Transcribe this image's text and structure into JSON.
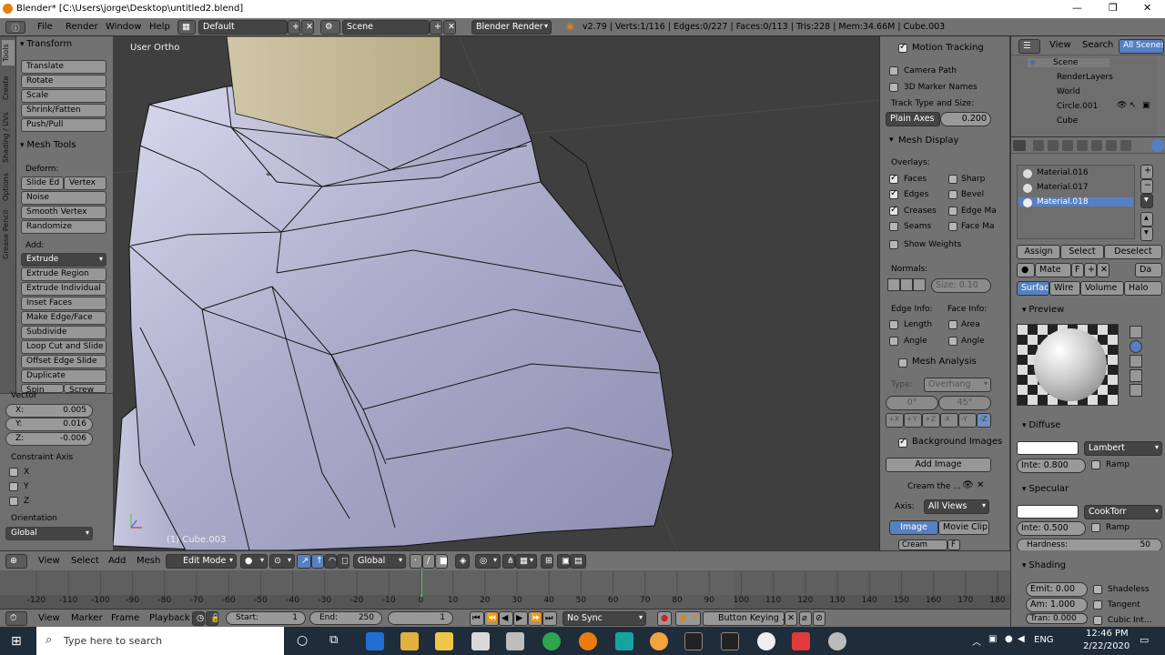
{
  "window": {
    "title": "Blender* [C:\\Users\\jorge\\Desktop\\untitled2.blend]"
  },
  "menus": [
    "File",
    "Render",
    "Window",
    "Help"
  ],
  "layout": "Default",
  "scene": "Scene",
  "engine": "Blender Render",
  "stats": "v2.79 | Verts:1/116 | Edges:0/227 | Faces:0/113 | Tris:228 | Mem:34.66M | Cube.003",
  "tabs": [
    "Tools",
    "Create",
    "Shading / UVs",
    "Options",
    "Grease Pencil"
  ],
  "toolshelf": {
    "transform": {
      "title": "Transform",
      "buttons": [
        "Translate",
        "Rotate",
        "Scale",
        "Shrink/Fatten",
        "Push/Pull"
      ]
    },
    "mesh_tools": {
      "title": "Mesh Tools",
      "deform_label": "Deform:",
      "slide_edge": "Slide Ed",
      "vertex": "Vertex",
      "deform": [
        "Noise",
        "Smooth Vertex",
        "Randomize"
      ],
      "add_label": "Add:",
      "extrude": "Extrude",
      "add": [
        "Extrude Region",
        "Extrude Individual",
        "Inset Faces",
        "Make Edge/Face",
        "Subdivide",
        "Loop Cut and Slide",
        "Offset Edge Slide",
        "Duplicate"
      ],
      "spin": "Spin",
      "screw": "Screw"
    },
    "vector": {
      "title": "Vector",
      "x": "0.005",
      "y": "0.016",
      "z": "-0.006"
    },
    "constraint": {
      "title": "Constraint Axis",
      "axes": [
        "X",
        "Y",
        "Z"
      ]
    },
    "orientation": {
      "title": "Orientation",
      "value": "Global"
    }
  },
  "viewport": {
    "label": "User Ortho",
    "object": "(1) Cube.003"
  },
  "npanel": {
    "motion": {
      "title": "Motion Tracking",
      "camera_path": "Camera Path",
      "marker_names": "3D Marker Names",
      "track_label": "Track Type and Size:",
      "track_type": "Plain Axes",
      "size": "0.200"
    },
    "mesh_display": {
      "title": "Mesh Display",
      "overlays": "Overlays:",
      "faces": "Faces",
      "edges": "Edges",
      "creases": "Creases",
      "seams": "Seams",
      "sharp": "Sharp",
      "bevel": "Bevel",
      "edge_ma": "Edge Ma",
      "face_ma": "Face Ma",
      "show_weights": "Show Weights",
      "normals": "Normals:",
      "normal_size": "Size:  0.10",
      "edge_info": "Edge Info:",
      "face_info": "Face Info:",
      "length": "Length",
      "area": "Area",
      "angle1": "Angle",
      "angle2": "Angle"
    },
    "analysis": {
      "title": "Mesh Analysis",
      "type_label": "Type:",
      "type": "Overhang",
      "min": "0°",
      "max": "45°",
      "axes": [
        "+X",
        "+Y",
        "+Z",
        "-X",
        "-Y",
        "-Z"
      ]
    },
    "bg": {
      "title": "Background Images",
      "add": "Add Image",
      "item": "Cream the ...",
      "axis_label": "Axis:",
      "axis": "All Views",
      "image": "Image",
      "movie": "Movie Clip",
      "cream": "Cream",
      "f": "F"
    }
  },
  "outliner": {
    "view": "View",
    "search": "Search",
    "all": "All Scenes",
    "items": [
      "Scene",
      "RenderLayers",
      "World",
      "Circle.001",
      "Cube"
    ]
  },
  "props": {
    "materials": [
      "Material.016",
      "Material.017",
      "Material.018"
    ],
    "assign": "Assign",
    "select": "Select",
    "deselect": "Deselect",
    "mate": "Mate",
    "f": "F",
    "da": "Da",
    "tabs": [
      "Surface",
      "Wire",
      "Volume",
      "Halo"
    ],
    "preview": "Preview",
    "diffuse": {
      "title": "Diffuse",
      "shader": "Lambert",
      "inte": "Inte: 0.800",
      "ramp": "Ramp"
    },
    "specular": {
      "title": "Specular",
      "shader": "CookTorr",
      "inte": "Inte: 0.500",
      "ramp": "Ramp",
      "hardness_label": "Hardness:",
      "hardness": "50"
    },
    "shading": {
      "title": "Shading",
      "emit": "Emit: 0.00",
      "amb": "Am: 1.000",
      "tran": "Tran: 0.000",
      "shadeless": "Shadeless",
      "tangent": "Tangent",
      "cubic": "Cubic Int..."
    }
  },
  "vheader": {
    "view": "View",
    "select": "Select",
    "add": "Add",
    "mesh": "Mesh",
    "mode": "Edit Mode",
    "orient": "Global"
  },
  "timeline": {
    "ticks": [
      "-120",
      "-110",
      "-100",
      "-90",
      "-80",
      "-70",
      "-60",
      "-50",
      "-40",
      "-30",
      "-20",
      "-10",
      "0",
      "10",
      "20",
      "30",
      "40",
      "50",
      "60",
      "70",
      "80",
      "90",
      "100",
      "110",
      "120",
      "130",
      "140",
      "150",
      "160",
      "170",
      "180"
    ]
  },
  "theader": {
    "view": "View",
    "marker": "Marker",
    "frame": "Frame",
    "playback": "Playback",
    "start_label": "Start:",
    "start": "1",
    "end_label": "End:",
    "end": "250",
    "current": "1",
    "sync": "No Sync",
    "keying": "Button Keying ..."
  },
  "taskbar": {
    "search": "Type here to search",
    "lang": "ENG",
    "time": "12:46 PM",
    "date": "2/22/2020"
  }
}
